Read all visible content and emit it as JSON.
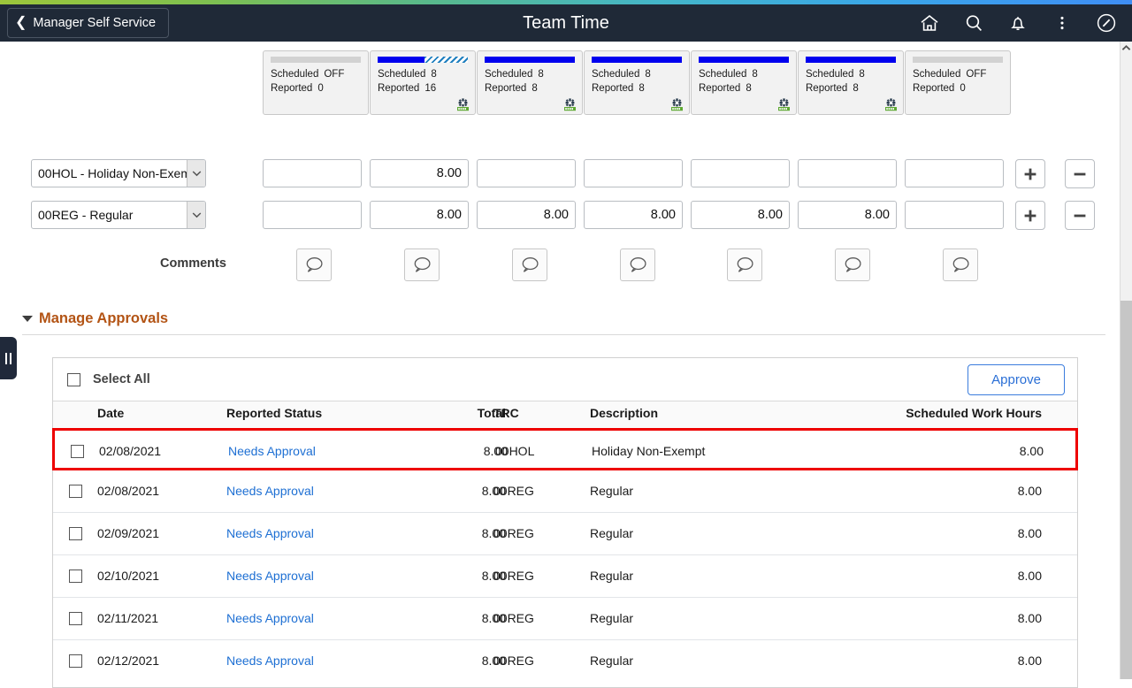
{
  "header": {
    "back_label": "Manager Self Service",
    "title": "Team Time",
    "icons": [
      {
        "name": "home-icon",
        "label": "Home"
      },
      {
        "name": "search-icon",
        "label": "Search"
      },
      {
        "name": "bell-icon",
        "label": "Notifications"
      },
      {
        "name": "kebab-menu-icon",
        "label": "Actions"
      },
      {
        "name": "compass-icon",
        "label": "NavBar"
      }
    ],
    "theme_colors": {
      "header_bg": "#1f2937",
      "gradient_start": "#9cc63b",
      "gradient_end": "#3f8ef5"
    }
  },
  "schedule_cards": {
    "scheduled_label": "Scheduled",
    "reported_label": "Reported",
    "items": [
      {
        "scheduled": "OFF",
        "reported": "0",
        "bar_type": "empty",
        "fill_pct": 0,
        "over_pct": 0,
        "has_gear": false
      },
      {
        "scheduled": "8",
        "reported": "16",
        "bar_type": "over",
        "fill_pct": 52,
        "over_pct": 48,
        "has_gear": true
      },
      {
        "scheduled": "8",
        "reported": "8",
        "bar_type": "full",
        "fill_pct": 100,
        "over_pct": 0,
        "has_gear": true
      },
      {
        "scheduled": "8",
        "reported": "8",
        "bar_type": "full",
        "fill_pct": 100,
        "over_pct": 0,
        "has_gear": true
      },
      {
        "scheduled": "8",
        "reported": "8",
        "bar_type": "full",
        "fill_pct": 100,
        "over_pct": 0,
        "has_gear": true
      },
      {
        "scheduled": "8",
        "reported": "8",
        "bar_type": "full",
        "fill_pct": 100,
        "over_pct": 0,
        "has_gear": true
      },
      {
        "scheduled": "OFF",
        "reported": "0",
        "bar_type": "empty",
        "fill_pct": 0,
        "over_pct": 0,
        "has_gear": false
      }
    ]
  },
  "time_entry": {
    "rows": [
      {
        "trc": "00HOL - Holiday Non-Exempt",
        "values": [
          "",
          "8.00",
          "",
          "",
          "",
          "",
          ""
        ],
        "add_label": "+",
        "remove_label": "−"
      },
      {
        "trc": "00REG - Regular",
        "values": [
          "",
          "8.00",
          "8.00",
          "8.00",
          "8.00",
          "8.00",
          ""
        ],
        "add_label": "+",
        "remove_label": "−"
      }
    ],
    "comments_label": "Comments",
    "comment_count": 7
  },
  "manage_approvals": {
    "section_title": "Manage Approvals",
    "select_all_label": "Select All",
    "approve_label": "Approve",
    "columns": [
      "Date",
      "Reported Status",
      "Total",
      "TRC",
      "Description",
      "Scheduled Work Hours"
    ],
    "rows": [
      {
        "date": "02/08/2021",
        "status": "Needs Approval",
        "total": "8.00",
        "trc": "00HOL",
        "description": "Holiday Non-Exempt",
        "scheduled": "8.00",
        "highlighted": true
      },
      {
        "date": "02/08/2021",
        "status": "Needs Approval",
        "total": "8.00",
        "trc": "00REG",
        "description": "Regular",
        "scheduled": "8.00",
        "highlighted": false
      },
      {
        "date": "02/09/2021",
        "status": "Needs Approval",
        "total": "8.00",
        "trc": "00REG",
        "description": "Regular",
        "scheduled": "8.00",
        "highlighted": false
      },
      {
        "date": "02/10/2021",
        "status": "Needs Approval",
        "total": "8.00",
        "trc": "00REG",
        "description": "Regular",
        "scheduled": "8.00",
        "highlighted": false
      },
      {
        "date": "02/11/2021",
        "status": "Needs Approval",
        "total": "8.00",
        "trc": "00REG",
        "description": "Regular",
        "scheduled": "8.00",
        "highlighted": false
      },
      {
        "date": "02/12/2021",
        "status": "Needs Approval",
        "total": "8.00",
        "trc": "00REG",
        "description": "Regular",
        "scheduled": "8.00",
        "highlighted": false
      }
    ],
    "accent_colors": {
      "section_title": "#b35415",
      "link": "#1d6fd3",
      "approve_border": "#3b7ddd",
      "highlight_border": "#ee0000"
    }
  }
}
